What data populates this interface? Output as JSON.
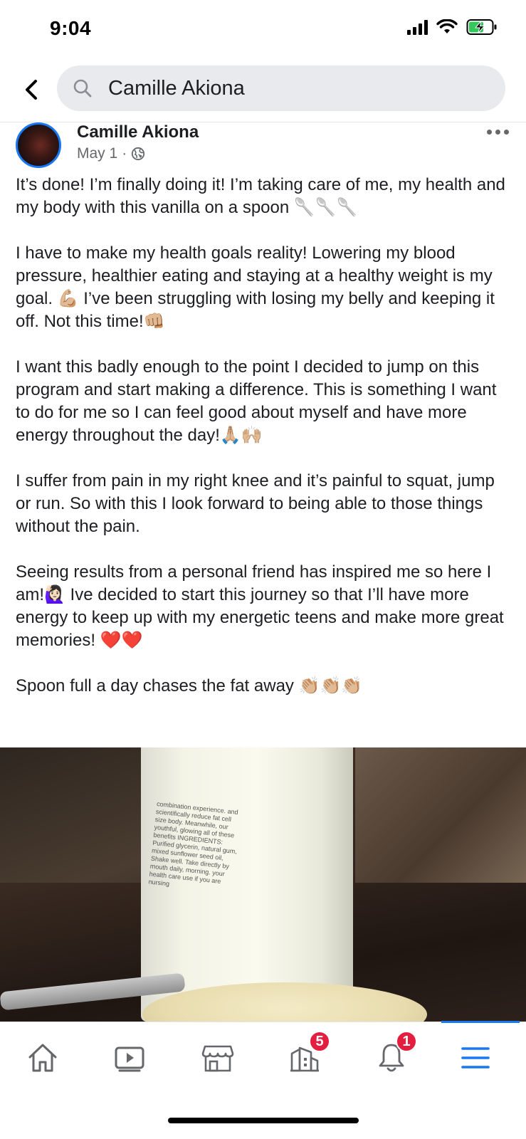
{
  "status_bar": {
    "time": "9:04"
  },
  "search": {
    "query": "Camille Akiona"
  },
  "post": {
    "author": "Camille Akiona",
    "date": "May 1",
    "date_separator": "·",
    "paragraphs": [
      "It’s done! I’m finally doing it! I’m taking care of me, my health and my body with this vanilla on a spoon 🥄🥄🥄",
      "I have to make my health goals reality! Lowering my blood pressure, healthier eating and staying at a healthy weight is my goal. 💪🏼 I’ve been struggling with losing my belly and keeping it off. Not this time!👊🏼",
      "I want this badly enough to the point I decided to jump on this program and start making a difference. This is something I want to do for me so I can feel good about myself and have more energy throughout the day!🙏🏼🙌🏼",
      "I suffer from pain in my right knee and it’s painful to squat, jump or run. So with this I look forward to being able to those things without the pain.",
      "Seeing results from a personal friend has inspired me so here I am!🙋🏻‍♀️ Ive decided to start this journey so that I’ll have more energy to keep up with my energetic teens and make more great memories! ❤️❤️",
      "Spoon full a day chases the fat away 👏🏼👏🏼👏🏼"
    ],
    "photo_label_text": "combination experience. and scientifically reduce fat cell size body. Meanwhile, our youthful, glowing all of these benefits INGREDIENTS: Purified glycerin, natural gum, mixed sunflower seed oil, Shake well. Take directly by mouth daily, morning. your health care use if you are nursing"
  },
  "bottom_nav": {
    "items": [
      {
        "name": "home",
        "badge": ""
      },
      {
        "name": "watch",
        "badge": ""
      },
      {
        "name": "marketplace",
        "badge": ""
      },
      {
        "name": "pages",
        "badge": "5"
      },
      {
        "name": "notifications",
        "badge": "1"
      },
      {
        "name": "menu",
        "badge": ""
      }
    ]
  },
  "colors": {
    "accent": "#1877f2",
    "badge": "#e41e3f",
    "text": "#1c1e21",
    "secondary": "#65676b",
    "search_bg": "#e9eaee"
  }
}
